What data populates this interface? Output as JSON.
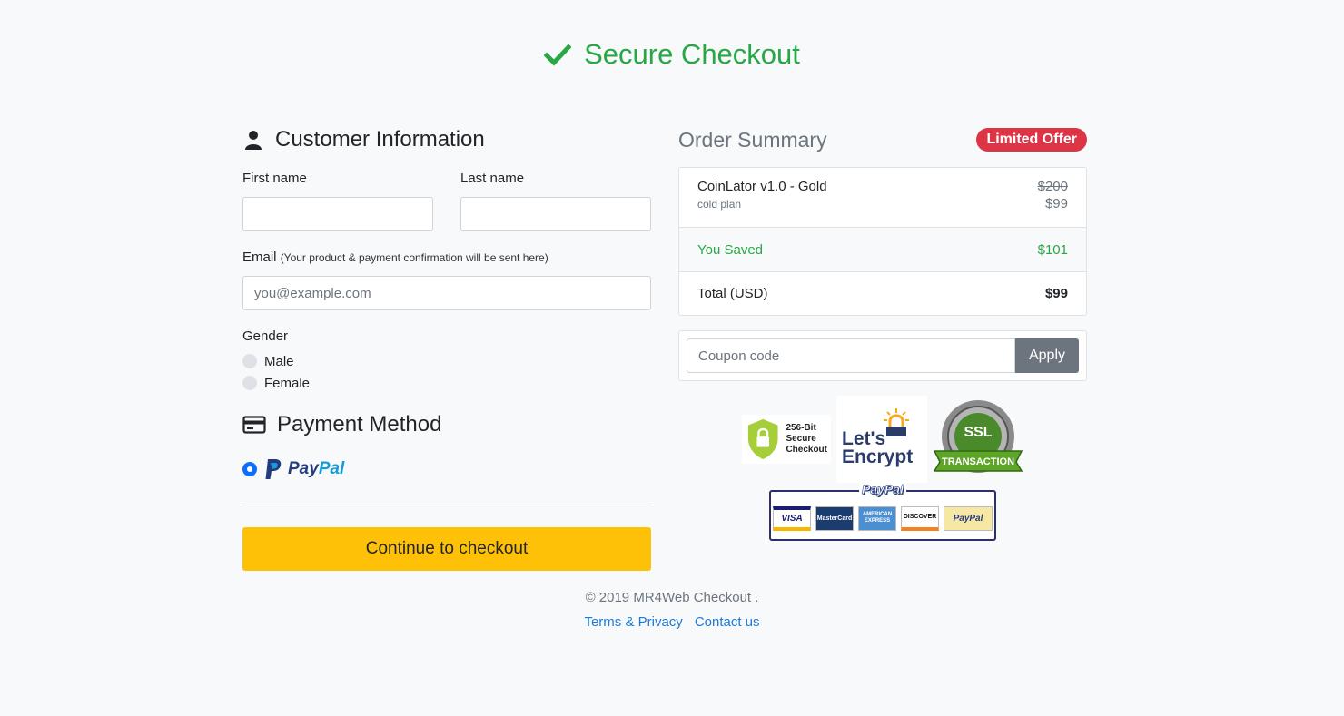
{
  "header": {
    "title": "Secure Checkout",
    "icon": "checkmark-icon",
    "color": "#28a745"
  },
  "customer": {
    "section_title": "Customer Information",
    "icon": "user-icon",
    "first_name_label": "First name",
    "first_name_value": "",
    "last_name_label": "Last name",
    "last_name_value": "",
    "email_label": "Email",
    "email_hint": "(Your product & payment confirmation will be sent here)",
    "email_placeholder": "you@example.com",
    "gender_label": "Gender",
    "gender_options": [
      "Male",
      "Female"
    ]
  },
  "payment": {
    "section_title": "Payment Method",
    "icon": "credit-card-icon",
    "method_part1": "Pay",
    "method_part2": "Pal",
    "selected": "PayPal"
  },
  "checkout_button": "Continue to checkout",
  "order": {
    "title": "Order Summary",
    "badge": "Limited Offer",
    "badge_color": "#dc3545",
    "product_name": "CoinLator v1.0 - Gold",
    "product_sub": "cold plan",
    "old_price": "$200",
    "new_price": "$99",
    "saved_label": "You Saved",
    "saved_value": "$101",
    "total_label": "Total (USD)",
    "total_value": "$99"
  },
  "coupon": {
    "placeholder": "Coupon code",
    "apply_label": "Apply"
  },
  "trust": {
    "b256_line1": "256-Bit",
    "b256_line2": "Secure",
    "b256_line3": "Checkout",
    "letsencrypt_line1": "Let's",
    "letsencrypt_line2": "Encrypt",
    "ssl_line1": "SSL",
    "ssl_line2": "TRANSACTION",
    "paypal_card_title": "PayPal",
    "cards": [
      "VISA",
      "MasterCard",
      "AMERICAN EXPRESS",
      "DISCOVER",
      "PayPal"
    ]
  },
  "footer": {
    "copyright": "© 2019 MR4Web Checkout .",
    "links": [
      "Terms & Privacy",
      "Contact us"
    ]
  }
}
